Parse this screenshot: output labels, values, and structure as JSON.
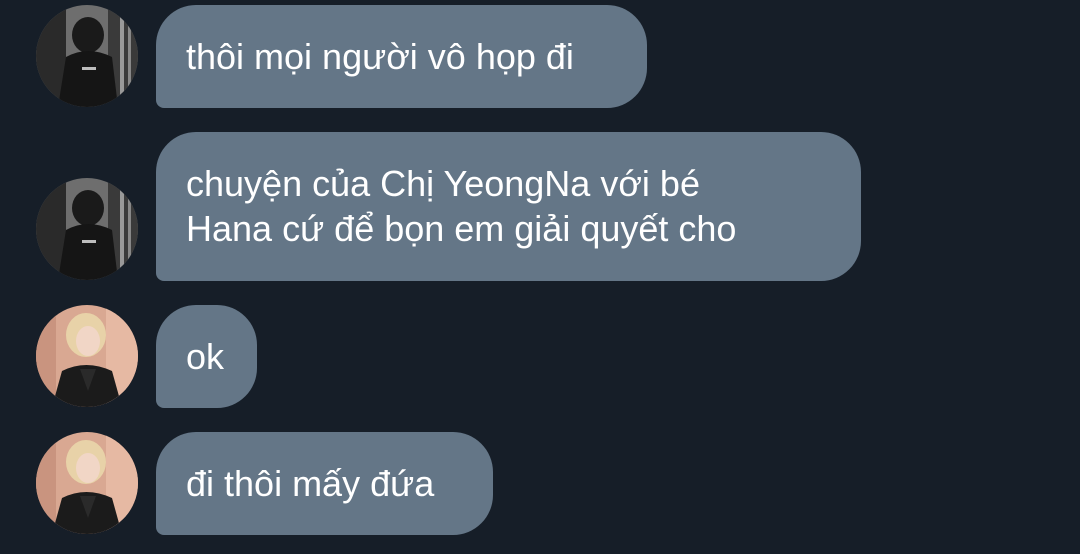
{
  "messages": [
    {
      "sender": "user-dark",
      "lines": [
        "thôi mọi người vô họp đi"
      ]
    },
    {
      "sender": "user-dark",
      "lines": [
        "chuyện của Chị YeongNa với bé",
        "Hana cứ để bọn em giải quyết cho"
      ]
    },
    {
      "sender": "user-blonde",
      "lines": [
        "ok"
      ]
    },
    {
      "sender": "user-blonde",
      "lines": [
        "đi thôi mấy đứa"
      ]
    }
  ],
  "colors": {
    "background": "#161e28",
    "bubble": "#647687",
    "text": "#ffffff"
  },
  "icons": {
    "avatar_dark": "avatar-monochrome-person-icon",
    "avatar_blonde": "avatar-blonde-person-icon"
  }
}
